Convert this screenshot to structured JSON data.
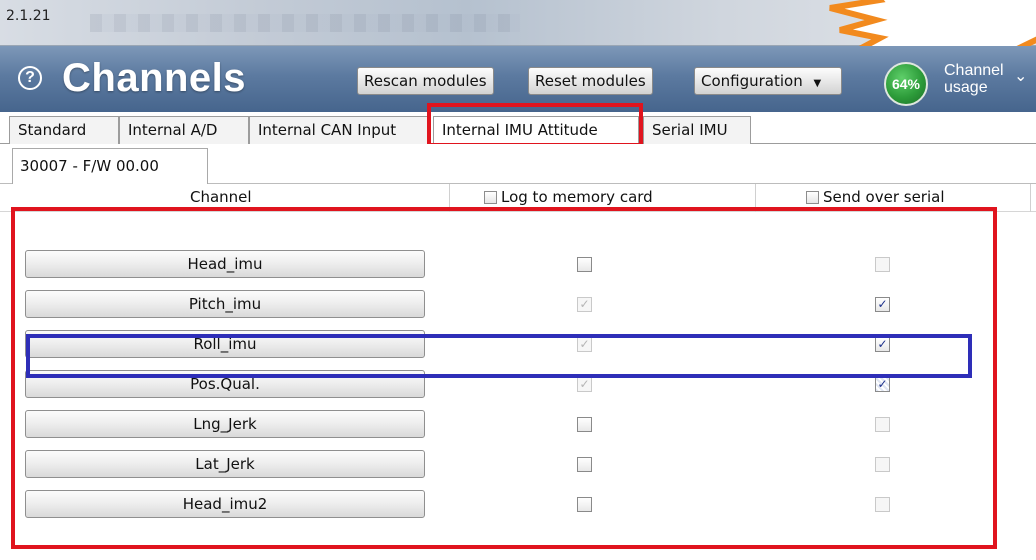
{
  "app": {
    "version": "2.1.21"
  },
  "header": {
    "title": "Channels",
    "buttons": {
      "rescan": "Rescan modules",
      "reset": "Reset modules",
      "configuration": "Configuration"
    },
    "usage": {
      "percent_label": "64%",
      "percent": 64,
      "label": "Channel usage"
    }
  },
  "tabs": [
    {
      "label": "Standard"
    },
    {
      "label": "Internal A/D"
    },
    {
      "label": "Internal CAN Input"
    },
    {
      "label": "Internal IMU Attitude",
      "active": true
    },
    {
      "label": "Serial IMU"
    }
  ],
  "subtab": {
    "label": "30007 - F/W 00.00"
  },
  "columns": {
    "channel": "Channel",
    "log": "Log to memory card",
    "send": "Send over serial"
  },
  "rows": [
    {
      "name": "Head_imu",
      "log": "unchecked",
      "send": "disabled"
    },
    {
      "name": "Pitch_imu",
      "log": "disabled-checked",
      "send": "checked"
    },
    {
      "name": "Roll_imu",
      "log": "disabled-checked",
      "send": "checked"
    },
    {
      "name": "Pos.Qual.",
      "log": "disabled-checked",
      "send": "checked-focus"
    },
    {
      "name": "Lng_Jerk",
      "log": "unchecked",
      "send": "disabled"
    },
    {
      "name": "Lat_Jerk",
      "log": "unchecked",
      "send": "disabled"
    },
    {
      "name": "Head_imu2",
      "log": "unchecked",
      "send": "disabled"
    }
  ],
  "colors": {
    "header": "#46658d",
    "highlight_red": "#e0141e",
    "highlight_blue": "#2e2eb8",
    "usage_green": "#2d9c3a",
    "burst_orange": "#f28a1e"
  },
  "icons": [
    "help-icon",
    "chevron-down-icon",
    "checkbox-icon",
    "check-icon"
  ]
}
